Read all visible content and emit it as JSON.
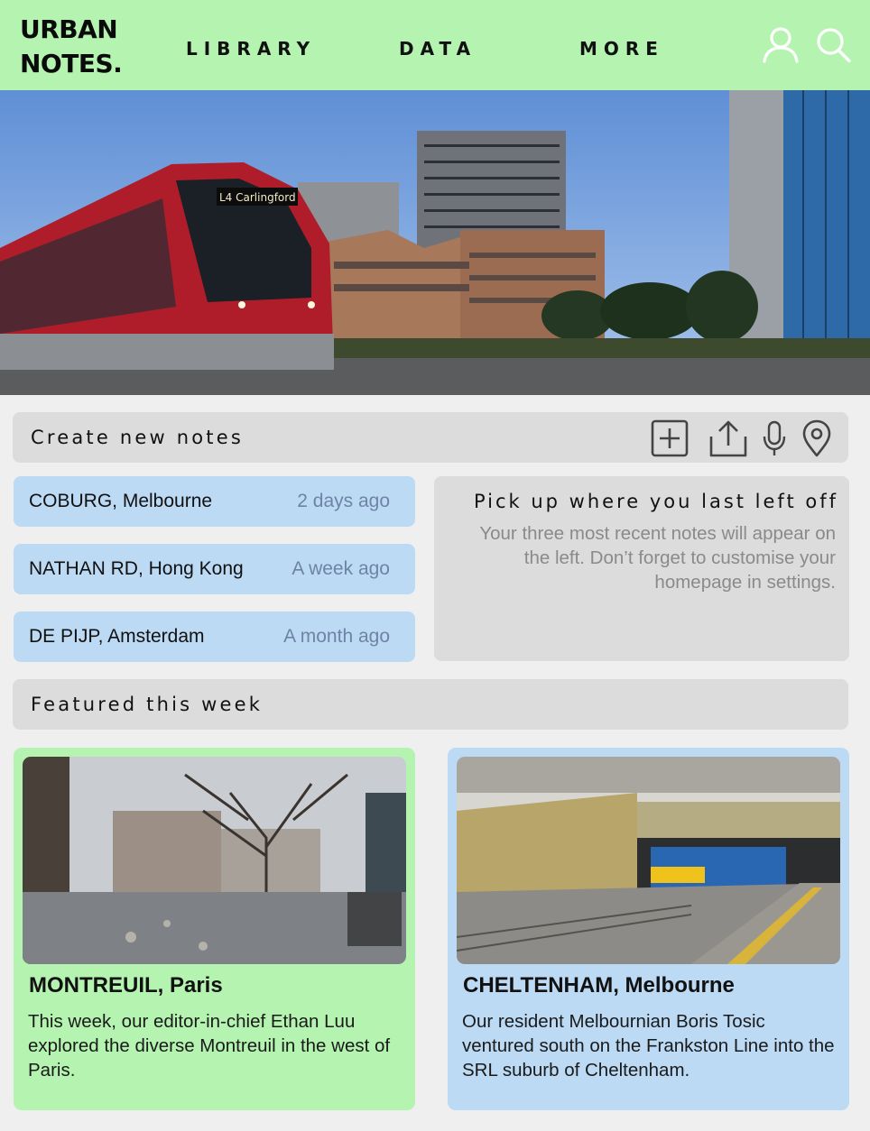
{
  "header": {
    "logo_line1": "URBAN",
    "logo_line2": "NOTES.",
    "nav": [
      "LIBRARY",
      "DATA",
      "MORE"
    ],
    "icons": [
      "user-icon",
      "search-icon"
    ]
  },
  "hero": {
    "tram_sign": "L4 Carlingford",
    "image": "tram-street-photo"
  },
  "create_notes": {
    "title": "Create new notes",
    "tools": [
      "add-icon",
      "upload-icon",
      "microphone-icon",
      "location-pin-icon"
    ]
  },
  "recent_notes": [
    {
      "place": "COBURG, Melbourne",
      "time": "2 days ago"
    },
    {
      "place": "NATHAN RD, Hong Kong",
      "time": "A week ago"
    },
    {
      "place": "DE PIJP, Amsterdam",
      "time": "A month ago"
    }
  ],
  "pickup": {
    "title": "Pick up where you last left off",
    "text": "Your three most recent notes will appear on the left. Don’t forget to customise your homepage in settings."
  },
  "featured": {
    "title": "Featured this week",
    "cards": [
      {
        "title": "MONTREUIL, Paris",
        "text": "This week, our editor-in-chief Ethan Luu explored the diverse Montreuil in the west of Paris."
      },
      {
        "title": "CHELTENHAM, Melbourne",
        "text": "Our resident Melbournian Boris Tosic ventured south on the Frankston Line into the SRL suburb of Cheltenham."
      }
    ]
  },
  "colors": {
    "header_bg": "#b4f4b0",
    "note_blue": "#bcdaf4",
    "panel_grey": "#dcdcdc",
    "time_text": "#6e83a6"
  }
}
